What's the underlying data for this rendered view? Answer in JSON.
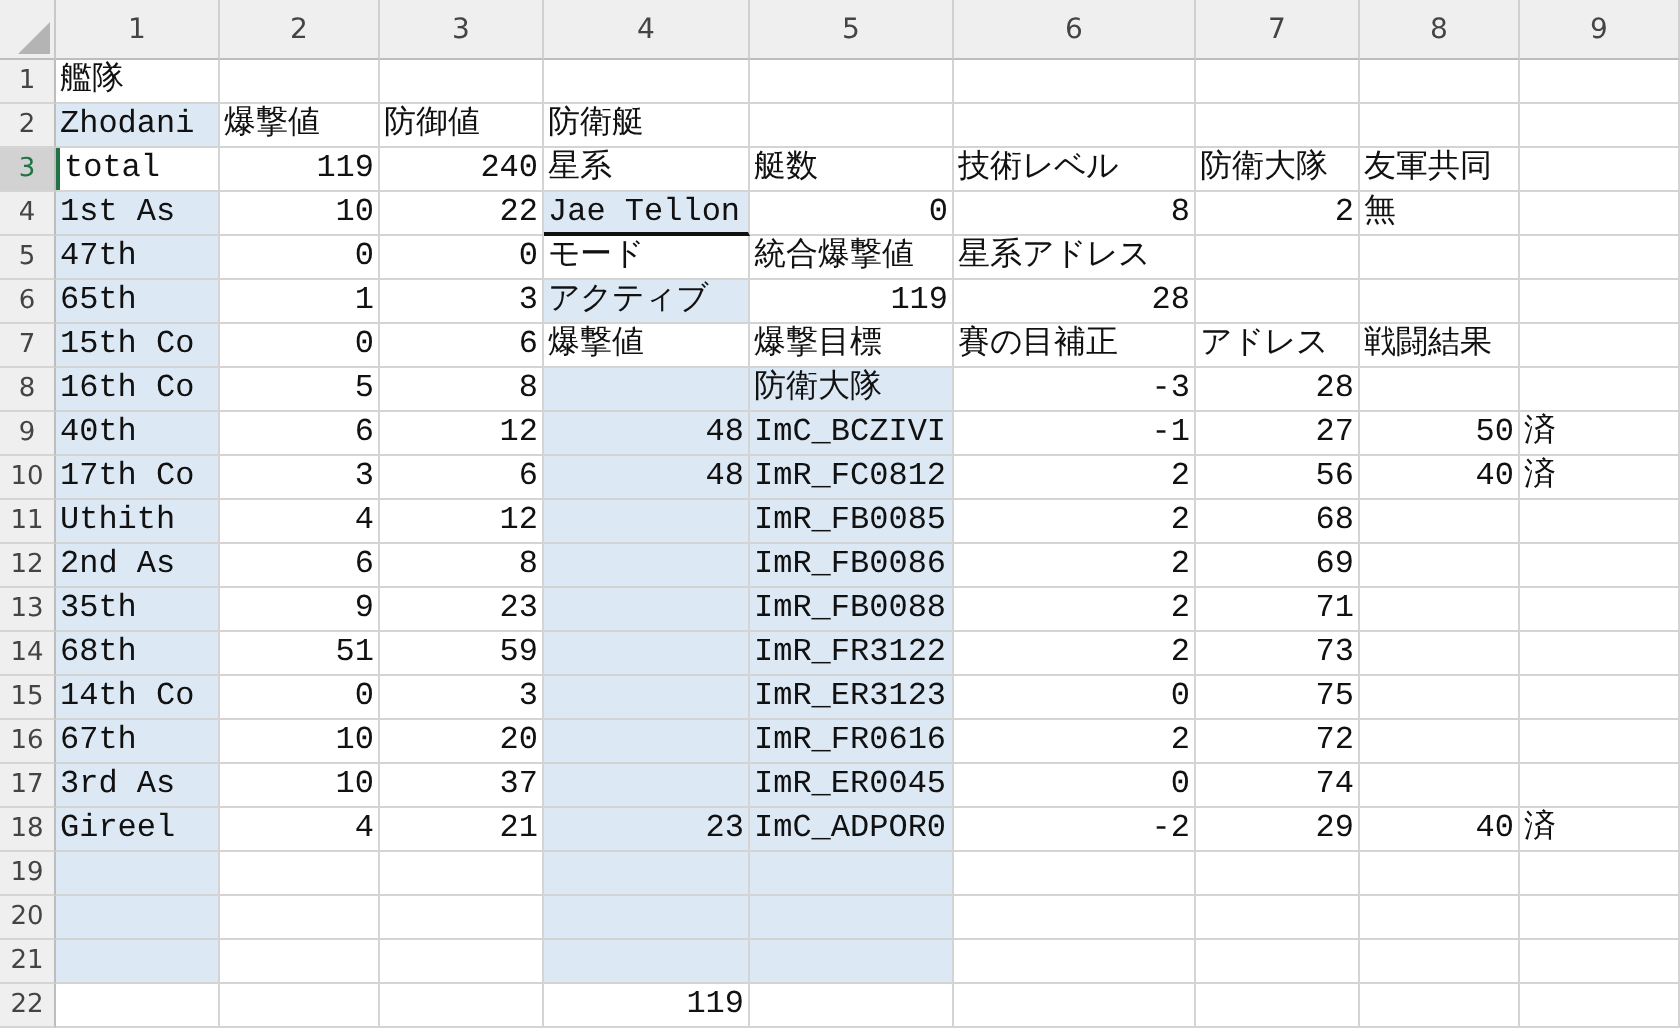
{
  "columns": [
    "1",
    "2",
    "3",
    "4",
    "5",
    "6",
    "7",
    "8",
    "9"
  ],
  "rows": [
    {
      "number": "1",
      "selected": false,
      "cells": [
        {
          "text": "艦隊",
          "kind": "text",
          "shaded": false
        },
        {
          "kind": "blank",
          "shaded": false
        },
        {
          "kind": "blank",
          "shaded": false
        },
        {
          "kind": "blank",
          "shaded": false
        },
        {
          "kind": "blank",
          "shaded": false
        },
        {
          "kind": "blank",
          "shaded": false
        },
        {
          "kind": "blank",
          "shaded": false
        },
        {
          "kind": "blank",
          "shaded": false
        },
        {
          "kind": "blank",
          "shaded": false
        }
      ]
    },
    {
      "number": "2",
      "selected": false,
      "cells": [
        {
          "text": "Zhodani",
          "kind": "text",
          "shaded": true
        },
        {
          "text": "爆撃値",
          "kind": "text",
          "shaded": false
        },
        {
          "text": "防御値",
          "kind": "text",
          "shaded": false
        },
        {
          "text": "防衛艇",
          "kind": "text",
          "shaded": false
        },
        {
          "kind": "blank",
          "shaded": false
        },
        {
          "kind": "blank",
          "shaded": false
        },
        {
          "kind": "blank",
          "shaded": false
        },
        {
          "kind": "blank",
          "shaded": false
        },
        {
          "kind": "blank",
          "shaded": false
        }
      ]
    },
    {
      "number": "3",
      "selected": true,
      "cells": [
        {
          "text": "total",
          "kind": "text",
          "shaded": false
        },
        {
          "text": "119",
          "kind": "number",
          "shaded": false
        },
        {
          "text": "240",
          "kind": "number",
          "shaded": false
        },
        {
          "text": "星系",
          "kind": "text",
          "shaded": false
        },
        {
          "text": "艇数",
          "kind": "text",
          "shaded": false
        },
        {
          "text": "技術レベル",
          "kind": "text",
          "shaded": false
        },
        {
          "text": "防衛大隊",
          "kind": "text",
          "shaded": false
        },
        {
          "text": "友軍共同",
          "kind": "text",
          "shaded": false
        },
        {
          "kind": "blank",
          "shaded": false
        }
      ]
    },
    {
      "number": "4",
      "selected": false,
      "cells": [
        {
          "text": "1st As",
          "kind": "text",
          "shaded": true
        },
        {
          "text": "10",
          "kind": "number",
          "shaded": false
        },
        {
          "text": "22",
          "kind": "number",
          "shaded": false
        },
        {
          "text": "Jae Tellon",
          "kind": "underlined",
          "shaded": true
        },
        {
          "text": "0",
          "kind": "number",
          "shaded": false
        },
        {
          "text": "8",
          "kind": "number",
          "shaded": false
        },
        {
          "text": "2",
          "kind": "number",
          "shaded": false
        },
        {
          "text": "無",
          "kind": "text",
          "shaded": false
        },
        {
          "kind": "blank",
          "shaded": false
        }
      ]
    },
    {
      "number": "5",
      "selected": false,
      "cells": [
        {
          "text": "47th",
          "kind": "text",
          "shaded": true
        },
        {
          "text": "0",
          "kind": "number",
          "shaded": false
        },
        {
          "text": "0",
          "kind": "number",
          "shaded": false
        },
        {
          "text": "モード",
          "kind": "text",
          "shaded": false
        },
        {
          "text": "統合爆撃値",
          "kind": "text",
          "shaded": false
        },
        {
          "text": "星系アドレス",
          "kind": "text",
          "shaded": false
        },
        {
          "kind": "blank",
          "shaded": false
        },
        {
          "kind": "blank",
          "shaded": false
        },
        {
          "kind": "blank",
          "shaded": false
        }
      ]
    },
    {
      "number": "6",
      "selected": false,
      "cells": [
        {
          "text": "65th",
          "kind": "text",
          "shaded": true
        },
        {
          "text": "1",
          "kind": "number",
          "shaded": false
        },
        {
          "text": "3",
          "kind": "number",
          "shaded": false
        },
        {
          "text": "アクティブ",
          "kind": "text",
          "shaded": true
        },
        {
          "text": "119",
          "kind": "number",
          "shaded": false
        },
        {
          "text": "28",
          "kind": "number",
          "shaded": false
        },
        {
          "kind": "blank",
          "shaded": false
        },
        {
          "kind": "blank",
          "shaded": false
        },
        {
          "kind": "blank",
          "shaded": false
        }
      ]
    },
    {
      "number": "7",
      "selected": false,
      "cells": [
        {
          "text": "15th Co",
          "kind": "text",
          "shaded": true
        },
        {
          "text": "0",
          "kind": "number",
          "shaded": false
        },
        {
          "text": "6",
          "kind": "number",
          "shaded": false
        },
        {
          "text": "爆撃値",
          "kind": "text",
          "shaded": false
        },
        {
          "text": "爆撃目標",
          "kind": "text",
          "shaded": false
        },
        {
          "text": "賽の目補正",
          "kind": "text",
          "shaded": false
        },
        {
          "text": "アドレス",
          "kind": "text",
          "shaded": false
        },
        {
          "text": "戦闘結果",
          "kind": "text",
          "shaded": false
        },
        {
          "kind": "blank",
          "shaded": false
        }
      ]
    },
    {
      "number": "8",
      "selected": false,
      "cells": [
        {
          "text": "16th Co",
          "kind": "text",
          "shaded": true
        },
        {
          "text": "5",
          "kind": "number",
          "shaded": false
        },
        {
          "text": "8",
          "kind": "number",
          "shaded": false
        },
        {
          "kind": "blank",
          "shaded": true
        },
        {
          "text": "防衛大隊",
          "kind": "text",
          "shaded": true
        },
        {
          "text": "-3",
          "kind": "number",
          "shaded": false
        },
        {
          "text": "28",
          "kind": "number",
          "shaded": false
        },
        {
          "kind": "blank",
          "shaded": false
        },
        {
          "kind": "blank",
          "shaded": false
        }
      ]
    },
    {
      "number": "9",
      "selected": false,
      "cells": [
        {
          "text": "40th",
          "kind": "text",
          "shaded": true
        },
        {
          "text": "6",
          "kind": "number",
          "shaded": false
        },
        {
          "text": "12",
          "kind": "number",
          "shaded": false
        },
        {
          "text": "48",
          "kind": "number",
          "shaded": true
        },
        {
          "text": "ImC_BCZIVI",
          "kind": "text",
          "shaded": true
        },
        {
          "text": "-1",
          "kind": "number",
          "shaded": false
        },
        {
          "text": "27",
          "kind": "number",
          "shaded": false
        },
        {
          "text": "50",
          "kind": "number",
          "shaded": false
        },
        {
          "text": "済",
          "kind": "text",
          "shaded": false
        }
      ]
    },
    {
      "number": "10",
      "selected": false,
      "cells": [
        {
          "text": "17th Co",
          "kind": "text",
          "shaded": true
        },
        {
          "text": "3",
          "kind": "number",
          "shaded": false
        },
        {
          "text": "6",
          "kind": "number",
          "shaded": false
        },
        {
          "text": "48",
          "kind": "number",
          "shaded": true
        },
        {
          "text": "ImR_FC0812",
          "kind": "text",
          "shaded": true
        },
        {
          "text": "2",
          "kind": "number",
          "shaded": false
        },
        {
          "text": "56",
          "kind": "number",
          "shaded": false
        },
        {
          "text": "40",
          "kind": "number",
          "shaded": false
        },
        {
          "text": "済",
          "kind": "text",
          "shaded": false
        }
      ]
    },
    {
      "number": "11",
      "selected": false,
      "cells": [
        {
          "text": "Uthith",
          "kind": "text",
          "shaded": true
        },
        {
          "text": "4",
          "kind": "number",
          "shaded": false
        },
        {
          "text": "12",
          "kind": "number",
          "shaded": false
        },
        {
          "kind": "blank",
          "shaded": true
        },
        {
          "text": "ImR_FB0085",
          "kind": "text",
          "shaded": true
        },
        {
          "text": "2",
          "kind": "number",
          "shaded": false
        },
        {
          "text": "68",
          "kind": "number",
          "shaded": false
        },
        {
          "kind": "blank",
          "shaded": false
        },
        {
          "kind": "blank",
          "shaded": false
        }
      ]
    },
    {
      "number": "12",
      "selected": false,
      "cells": [
        {
          "text": "2nd As",
          "kind": "text",
          "shaded": true
        },
        {
          "text": "6",
          "kind": "number",
          "shaded": false
        },
        {
          "text": "8",
          "kind": "number",
          "shaded": false
        },
        {
          "kind": "blank",
          "shaded": true
        },
        {
          "text": "ImR_FB0086",
          "kind": "text",
          "shaded": true
        },
        {
          "text": "2",
          "kind": "number",
          "shaded": false
        },
        {
          "text": "69",
          "kind": "number",
          "shaded": false
        },
        {
          "kind": "blank",
          "shaded": false
        },
        {
          "kind": "blank",
          "shaded": false
        }
      ]
    },
    {
      "number": "13",
      "selected": false,
      "cells": [
        {
          "text": "35th",
          "kind": "text",
          "shaded": true
        },
        {
          "text": "9",
          "kind": "number",
          "shaded": false
        },
        {
          "text": "23",
          "kind": "number",
          "shaded": false
        },
        {
          "kind": "blank",
          "shaded": true
        },
        {
          "text": "ImR_FB0088",
          "kind": "text",
          "shaded": true
        },
        {
          "text": "2",
          "kind": "number",
          "shaded": false
        },
        {
          "text": "71",
          "kind": "number",
          "shaded": false
        },
        {
          "kind": "blank",
          "shaded": false
        },
        {
          "kind": "blank",
          "shaded": false
        }
      ]
    },
    {
      "number": "14",
      "selected": false,
      "cells": [
        {
          "text": "68th",
          "kind": "text",
          "shaded": true
        },
        {
          "text": "51",
          "kind": "number",
          "shaded": false
        },
        {
          "text": "59",
          "kind": "number",
          "shaded": false
        },
        {
          "kind": "blank",
          "shaded": true
        },
        {
          "text": "ImR_FR3122",
          "kind": "text",
          "shaded": true
        },
        {
          "text": "2",
          "kind": "number",
          "shaded": false
        },
        {
          "text": "73",
          "kind": "number",
          "shaded": false
        },
        {
          "kind": "blank",
          "shaded": false
        },
        {
          "kind": "blank",
          "shaded": false
        }
      ]
    },
    {
      "number": "15",
      "selected": false,
      "cells": [
        {
          "text": "14th Co",
          "kind": "text",
          "shaded": true
        },
        {
          "text": "0",
          "kind": "number",
          "shaded": false
        },
        {
          "text": "3",
          "kind": "number",
          "shaded": false
        },
        {
          "kind": "blank",
          "shaded": true
        },
        {
          "text": "ImR_ER3123",
          "kind": "text",
          "shaded": true
        },
        {
          "text": "0",
          "kind": "number",
          "shaded": false
        },
        {
          "text": "75",
          "kind": "number",
          "shaded": false
        },
        {
          "kind": "blank",
          "shaded": false
        },
        {
          "kind": "blank",
          "shaded": false
        }
      ]
    },
    {
      "number": "16",
      "selected": false,
      "cells": [
        {
          "text": "67th",
          "kind": "text",
          "shaded": true
        },
        {
          "text": "10",
          "kind": "number",
          "shaded": false
        },
        {
          "text": "20",
          "kind": "number",
          "shaded": false
        },
        {
          "kind": "blank",
          "shaded": true
        },
        {
          "text": "ImR_FR0616",
          "kind": "text",
          "shaded": true
        },
        {
          "text": "2",
          "kind": "number",
          "shaded": false
        },
        {
          "text": "72",
          "kind": "number",
          "shaded": false
        },
        {
          "kind": "blank",
          "shaded": false
        },
        {
          "kind": "blank",
          "shaded": false
        }
      ]
    },
    {
      "number": "17",
      "selected": false,
      "cells": [
        {
          "text": "3rd As",
          "kind": "text",
          "shaded": true
        },
        {
          "text": "10",
          "kind": "number",
          "shaded": false
        },
        {
          "text": "37",
          "kind": "number",
          "shaded": false
        },
        {
          "kind": "blank",
          "shaded": true
        },
        {
          "text": "ImR_ER0045",
          "kind": "text",
          "shaded": true
        },
        {
          "text": "0",
          "kind": "number",
          "shaded": false
        },
        {
          "text": "74",
          "kind": "number",
          "shaded": false
        },
        {
          "kind": "blank",
          "shaded": false
        },
        {
          "kind": "blank",
          "shaded": false
        }
      ]
    },
    {
      "number": "18",
      "selected": false,
      "cells": [
        {
          "text": "Gireel",
          "kind": "text",
          "shaded": true
        },
        {
          "text": "4",
          "kind": "number",
          "shaded": false
        },
        {
          "text": "21",
          "kind": "number",
          "shaded": false
        },
        {
          "text": "23",
          "kind": "number",
          "shaded": true
        },
        {
          "text": "ImC_ADPOR0",
          "kind": "text",
          "shaded": true
        },
        {
          "text": "-2",
          "kind": "number",
          "shaded": false
        },
        {
          "text": "29",
          "kind": "number",
          "shaded": false
        },
        {
          "text": "40",
          "kind": "number",
          "shaded": false
        },
        {
          "text": "済",
          "kind": "text",
          "shaded": false
        }
      ]
    },
    {
      "number": "19",
      "selected": false,
      "cells": [
        {
          "kind": "blank",
          "shaded": true
        },
        {
          "kind": "blank",
          "shaded": false
        },
        {
          "kind": "blank",
          "shaded": false
        },
        {
          "kind": "blank",
          "shaded": true
        },
        {
          "kind": "blank",
          "shaded": true
        },
        {
          "kind": "blank",
          "shaded": false
        },
        {
          "kind": "blank",
          "shaded": false
        },
        {
          "kind": "blank",
          "shaded": false
        },
        {
          "kind": "blank",
          "shaded": false
        }
      ]
    },
    {
      "number": "20",
      "selected": false,
      "cells": [
        {
          "kind": "blank",
          "shaded": true
        },
        {
          "kind": "blank",
          "shaded": false
        },
        {
          "kind": "blank",
          "shaded": false
        },
        {
          "kind": "blank",
          "shaded": true
        },
        {
          "kind": "blank",
          "shaded": true
        },
        {
          "kind": "blank",
          "shaded": false
        },
        {
          "kind": "blank",
          "shaded": false
        },
        {
          "kind": "blank",
          "shaded": false
        },
        {
          "kind": "blank",
          "shaded": false
        }
      ]
    },
    {
      "number": "21",
      "selected": false,
      "cells": [
        {
          "kind": "blank",
          "shaded": true
        },
        {
          "kind": "blank",
          "shaded": false
        },
        {
          "kind": "blank",
          "shaded": false
        },
        {
          "kind": "blank",
          "shaded": true
        },
        {
          "kind": "blank",
          "shaded": true
        },
        {
          "kind": "blank",
          "shaded": false
        },
        {
          "kind": "blank",
          "shaded": false
        },
        {
          "kind": "blank",
          "shaded": false
        },
        {
          "kind": "blank",
          "shaded": false
        }
      ]
    },
    {
      "number": "22",
      "selected": false,
      "cells": [
        {
          "kind": "blank",
          "shaded": false
        },
        {
          "kind": "blank",
          "shaded": false
        },
        {
          "kind": "blank",
          "shaded": false
        },
        {
          "text": "119",
          "kind": "number",
          "shaded": false
        },
        {
          "kind": "blank",
          "shaded": false
        },
        {
          "kind": "blank",
          "shaded": false
        },
        {
          "kind": "blank",
          "shaded": false
        },
        {
          "kind": "blank",
          "shaded": false
        },
        {
          "kind": "blank",
          "shaded": false
        }
      ]
    }
  ]
}
